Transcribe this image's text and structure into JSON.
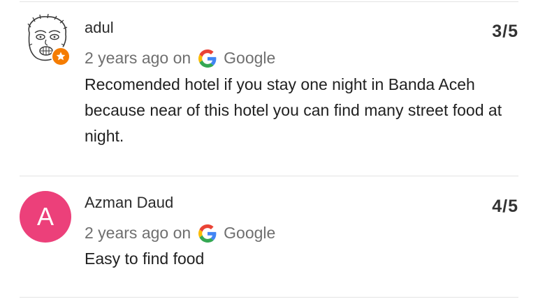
{
  "reviews": [
    {
      "reviewer_name": "adul",
      "avatar_icon": "hand-drawn-face-avatar",
      "badge_icon": "local-guide-star-icon",
      "badge_color": "#f57c00",
      "rating": "3/5",
      "time_ago": "2 years ago on",
      "source_icon": "google-g-icon",
      "source": "Google",
      "text": "Recomended hotel if you stay one night in Banda Aceh because near of this hotel you can find many street food at night."
    },
    {
      "reviewer_name": "Azman Daud",
      "avatar_letter": "A",
      "avatar_color": "#ec407a",
      "rating": "4/5",
      "time_ago": "2 years ago on",
      "source_icon": "google-g-icon",
      "source": "Google",
      "text": "Easy to find food"
    }
  ]
}
